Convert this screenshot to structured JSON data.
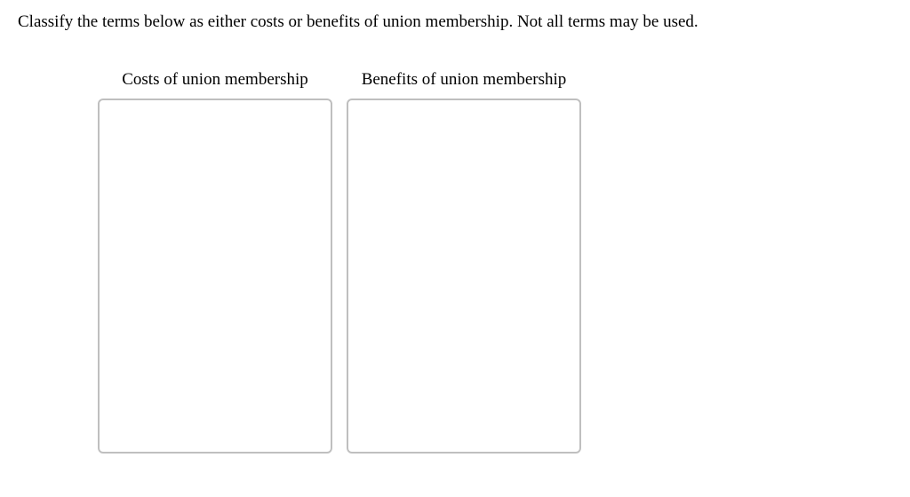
{
  "instruction": "Classify the terms below as either costs or benefits of union membership. Not all terms may be used.",
  "columns": {
    "costs": {
      "header": "Costs of union membership"
    },
    "benefits": {
      "header": "Benefits of union membership"
    }
  }
}
